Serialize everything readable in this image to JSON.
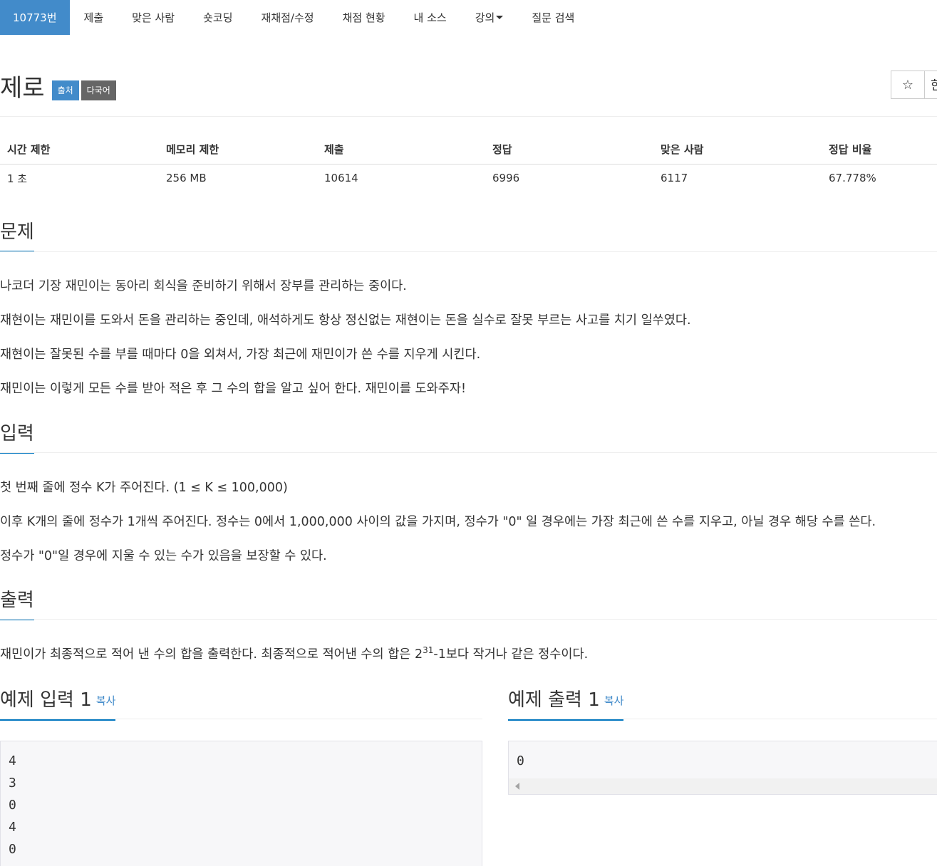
{
  "nav": {
    "problem_id": "10773번",
    "items": [
      "제출",
      "맞은 사람",
      "숏코딩",
      "재채점/수정",
      "채점 현황",
      "내 소스"
    ],
    "lecture": "강의",
    "qna": "질문 검색"
  },
  "problem": {
    "title": "제로",
    "badge_source": "출처",
    "badge_multilang": "다국어",
    "star_icon": "☆",
    "second_button_text": "한"
  },
  "info_table": {
    "headers": [
      "시간 제한",
      "메모리 제한",
      "제출",
      "정답",
      "맞은 사람",
      "정답 비율"
    ],
    "values": [
      "1 초",
      "256 MB",
      "10614",
      "6996",
      "6117",
      "67.778%"
    ]
  },
  "description": {
    "heading": "문제",
    "paragraphs": [
      "나코더 기장 재민이는 동아리 회식을 준비하기 위해서 장부를 관리하는 중이다.",
      "재현이는 재민이를 도와서 돈을 관리하는 중인데, 애석하게도 항상 정신없는 재현이는 돈을 실수로 잘못 부르는 사고를 치기 일쑤였다.",
      "재현이는 잘못된 수를 부를 때마다 0을 외쳐서, 가장 최근에 재민이가 쓴 수를 지우게 시킨다.",
      "재민이는 이렇게 모든 수를 받아 적은 후 그 수의 합을 알고 싶어 한다. 재민이를 도와주자!"
    ]
  },
  "input": {
    "heading": "입력",
    "paragraphs": [
      "첫 번째 줄에 정수 K가 주어진다. (1 ≤ K ≤ 100,000)",
      "이후 K개의 줄에 정수가 1개씩 주어진다. 정수는 0에서 1,000,000 사이의 값을 가지며, 정수가 \"0\" 일 경우에는 가장 최근에 쓴 수를 지우고, 아닐 경우 해당 수를 쓴다.",
      "정수가 \"0\"일 경우에 지울 수 있는 수가 있음을 보장할 수 있다."
    ]
  },
  "output": {
    "heading": "출력",
    "text_before": "재민이가 최종적으로 적어 낸 수의 합을 출력한다. 최종적으로 적어낸 수의 합은 2",
    "sup": "31",
    "text_after": "-1보다 작거나 같은 정수이다."
  },
  "samples": {
    "input_heading": "예제 입력 1",
    "output_heading": "예제 출력 1",
    "copy_label": "복사",
    "input_lines": [
      "4",
      "3",
      "0",
      "4",
      "0"
    ],
    "output_lines": [
      "0"
    ]
  }
}
